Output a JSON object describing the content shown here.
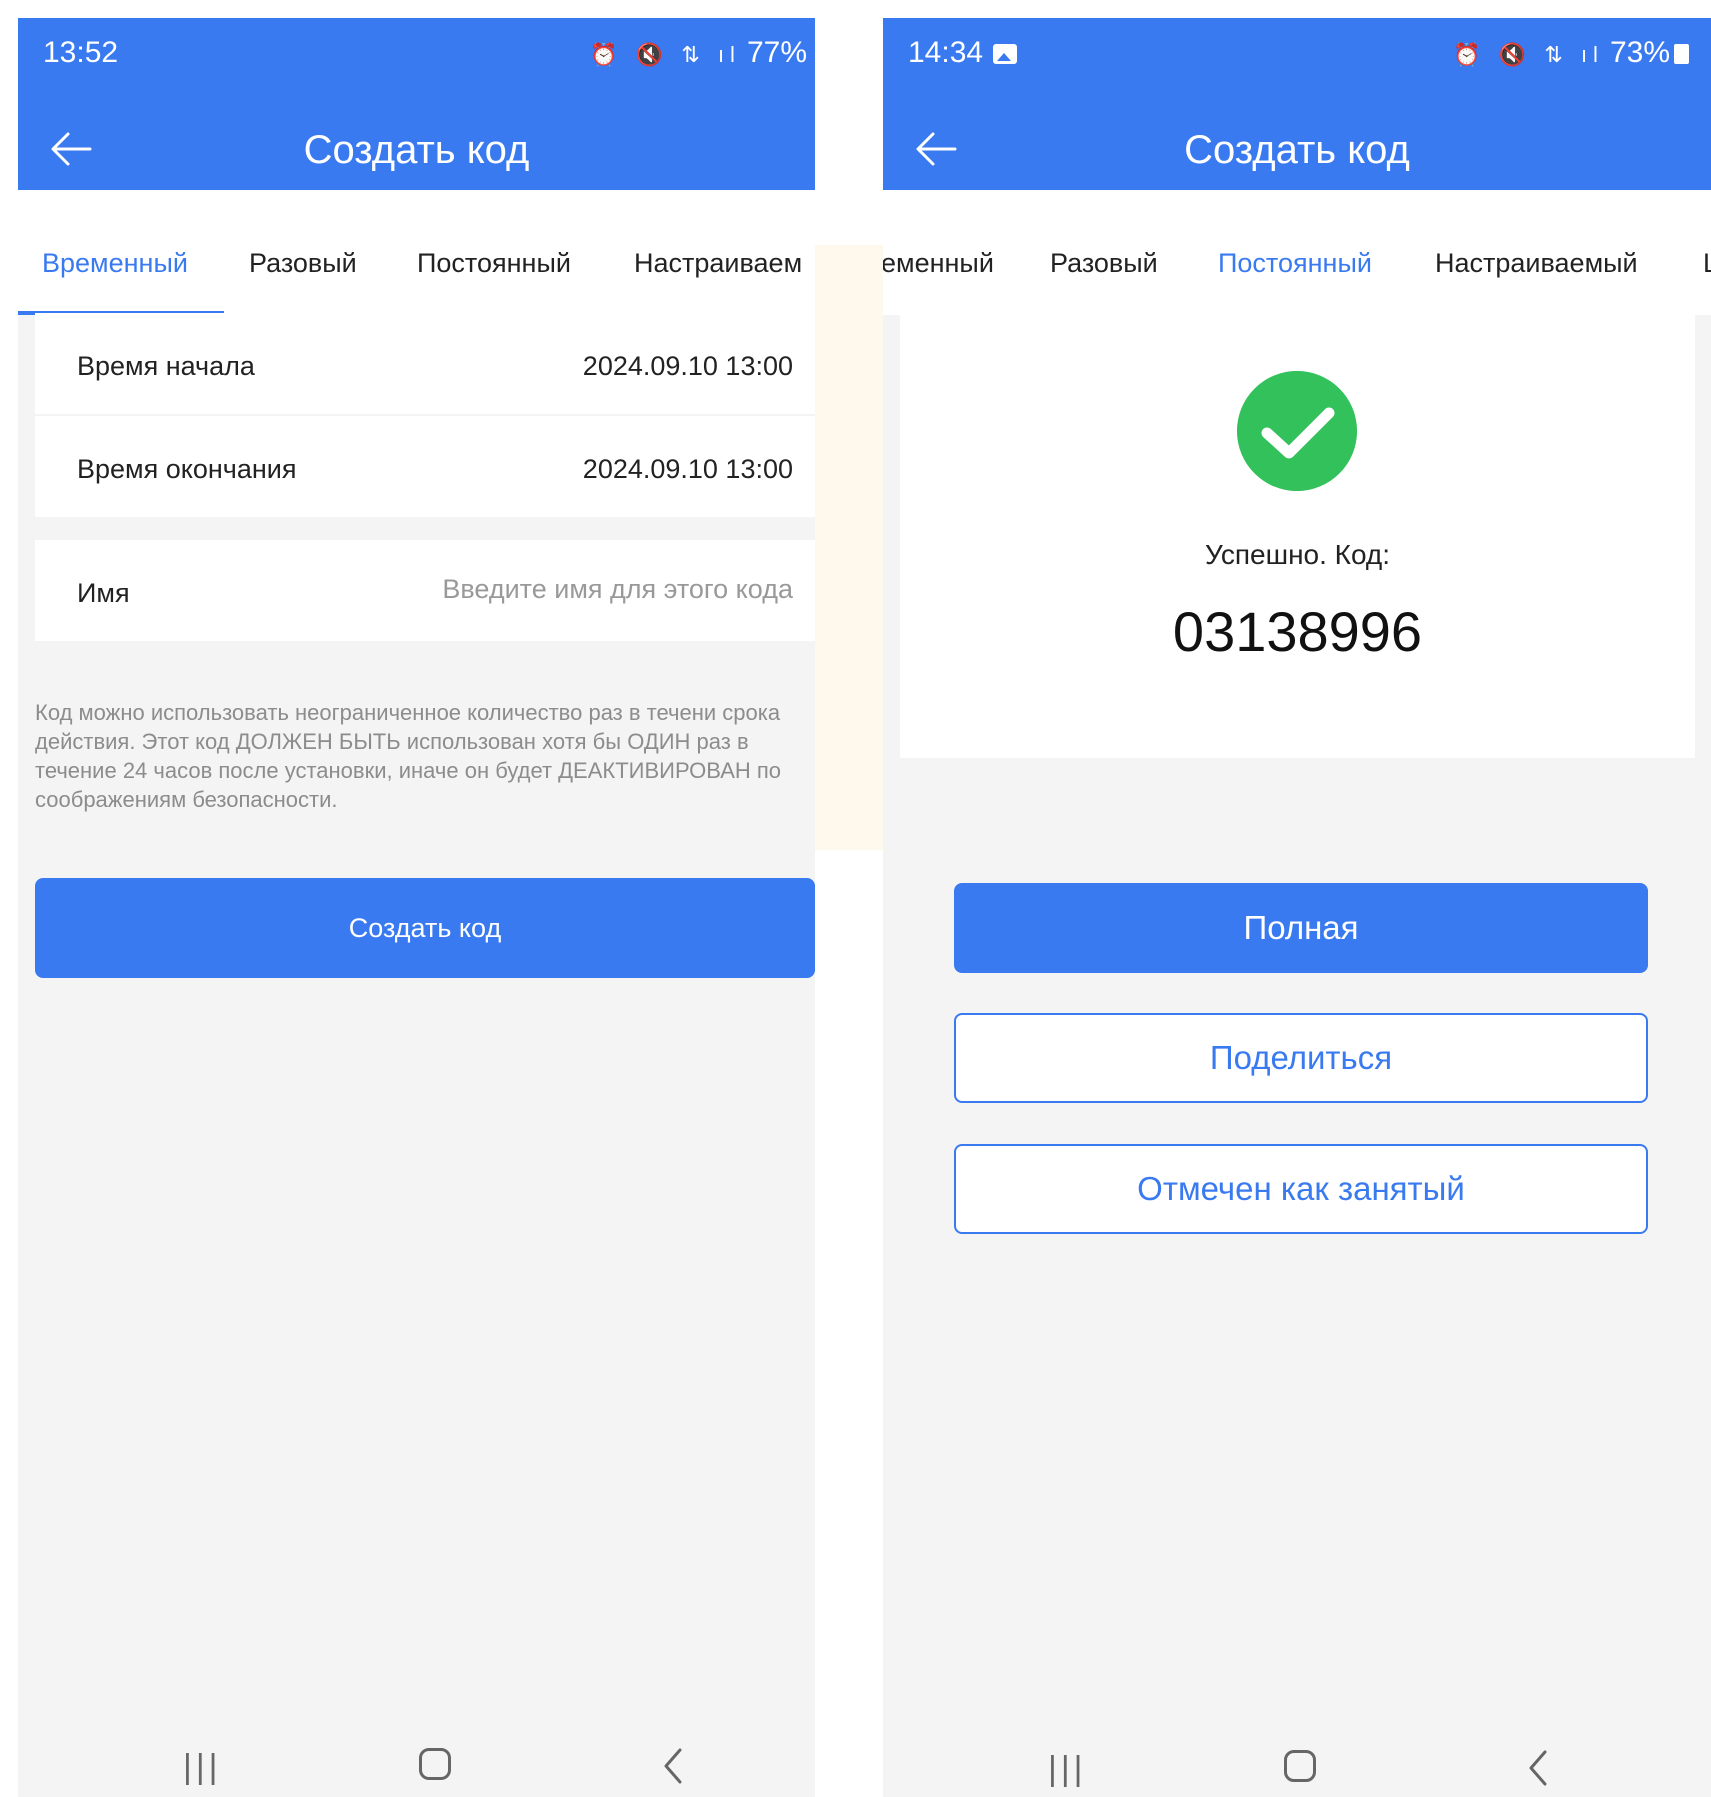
{
  "left": {
    "status": {
      "time": "13:52",
      "battery": "77%"
    },
    "appbar": {
      "title": "Создать код"
    },
    "tabs": [
      "Временный",
      "Разовый",
      "Постоянный",
      "Настраиваем"
    ],
    "active_tab": "Временный",
    "form": {
      "start_label": "Время начала",
      "start_value": "2024.09.10 13:00",
      "end_label": "Время окончания",
      "end_value": "2024.09.10 13:00",
      "name_label": "Имя",
      "name_placeholder": "Введите имя для этого кода",
      "note": "Код можно использовать неограниченное количество раз в течени срока действия. Этот код ДОЛЖЕН БЫТЬ использован хотя бы ОДИН раз в течение 24 часов после установки, иначе он будет ДЕАКТИВИРОВАН по соображениям безопасности.",
      "submit_label": "Создать код"
    }
  },
  "right": {
    "status": {
      "time": "14:34",
      "battery": "73%"
    },
    "appbar": {
      "title": "Создать код"
    },
    "tabs": [
      "еменный",
      "Разовый",
      "Постоянный",
      "Настраиваемый",
      "L"
    ],
    "active_tab": "Постоянный",
    "result": {
      "label": "Успешно. Код:",
      "code": "03138996"
    },
    "actions": {
      "full_label": "Полная",
      "share_label": "Поделиться",
      "mark_label": "Отмечен как занятый"
    }
  },
  "colors": {
    "primary": "#3a7af0",
    "success": "#32c15a",
    "background": "#f4f4f4",
    "hint": "#8c8c8c"
  },
  "icons": {
    "back": "arrow-left-icon",
    "success": "checkmark-circle-icon",
    "nav_recent": "recent-apps-icon",
    "nav_home": "home-icon",
    "nav_back": "chevron-left-icon"
  }
}
